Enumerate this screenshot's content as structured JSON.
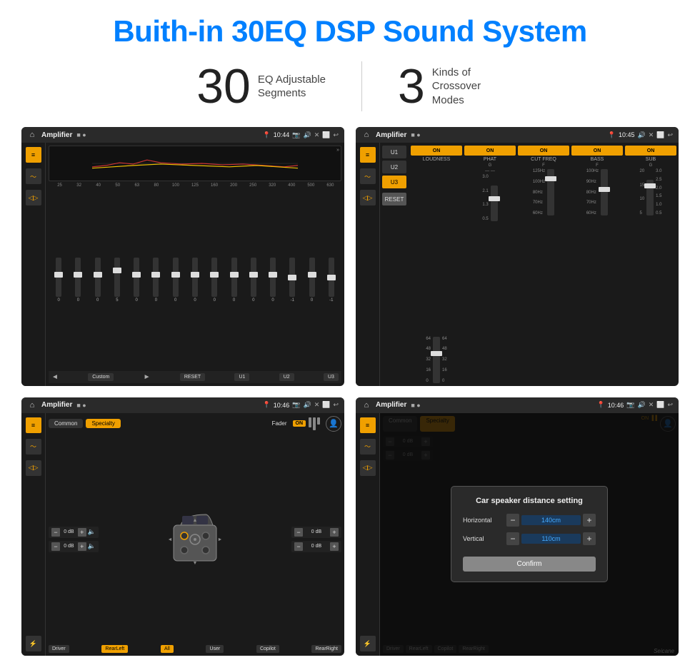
{
  "header": {
    "title": "Buith-in 30EQ DSP Sound System"
  },
  "stats": {
    "eq_number": "30",
    "eq_label_line1": "EQ Adjustable",
    "eq_label_line2": "Segments",
    "crossover_number": "3",
    "crossover_label_line1": "Kinds of",
    "crossover_label_line2": "Crossover Modes"
  },
  "screen1": {
    "topbar_title": "Amplifier",
    "time": "10:44",
    "eq_labels": [
      "25",
      "32",
      "40",
      "50",
      "63",
      "80",
      "100",
      "125",
      "160",
      "200",
      "250",
      "320",
      "400",
      "500",
      "630"
    ],
    "eq_values": [
      "0",
      "0",
      "0",
      "0",
      "5",
      "0",
      "0",
      "0",
      "0",
      "0",
      "0",
      "0",
      "0",
      "-1",
      "0",
      "-1"
    ],
    "preset_label": "Custom",
    "btn_reset": "RESET",
    "btn_u1": "U1",
    "btn_u2": "U2",
    "btn_u3": "U3"
  },
  "screen2": {
    "topbar_title": "Amplifier",
    "time": "10:45",
    "presets": [
      "U1",
      "U2",
      "U3"
    ],
    "active_preset": "U3",
    "channels": [
      "LOUDNESS",
      "PHAT",
      "CUT FREQ",
      "BASS",
      "SUB"
    ],
    "channel_on": true,
    "btn_reset": "RESET"
  },
  "screen3": {
    "topbar_title": "Amplifier",
    "time": "10:46",
    "tabs": [
      "Common",
      "Specialty"
    ],
    "active_tab": "Specialty",
    "fader_label": "Fader",
    "fader_on": "ON",
    "labels": {
      "driver": "Driver",
      "rear_left": "RearLeft",
      "all": "All",
      "copilot": "Copilot",
      "rear_right": "RearRight",
      "user": "User"
    },
    "db_values": [
      "0 dB",
      "0 dB",
      "0 dB",
      "0 dB"
    ]
  },
  "screen4": {
    "topbar_title": "Amplifier",
    "time": "10:46",
    "tabs": [
      "Common",
      "Specialty"
    ],
    "dialog": {
      "title": "Car speaker distance setting",
      "horizontal_label": "Horizontal",
      "horizontal_value": "140cm",
      "vertical_label": "Vertical",
      "vertical_value": "110cm",
      "confirm_label": "Confirm"
    },
    "labels": {
      "driver": "Driver",
      "rear_left": "RearLeft",
      "copilot": "Copilot",
      "rear_right": "RearRight"
    },
    "db_values": [
      "0 dB",
      "0 dB"
    ]
  },
  "watermark": "Seicane"
}
